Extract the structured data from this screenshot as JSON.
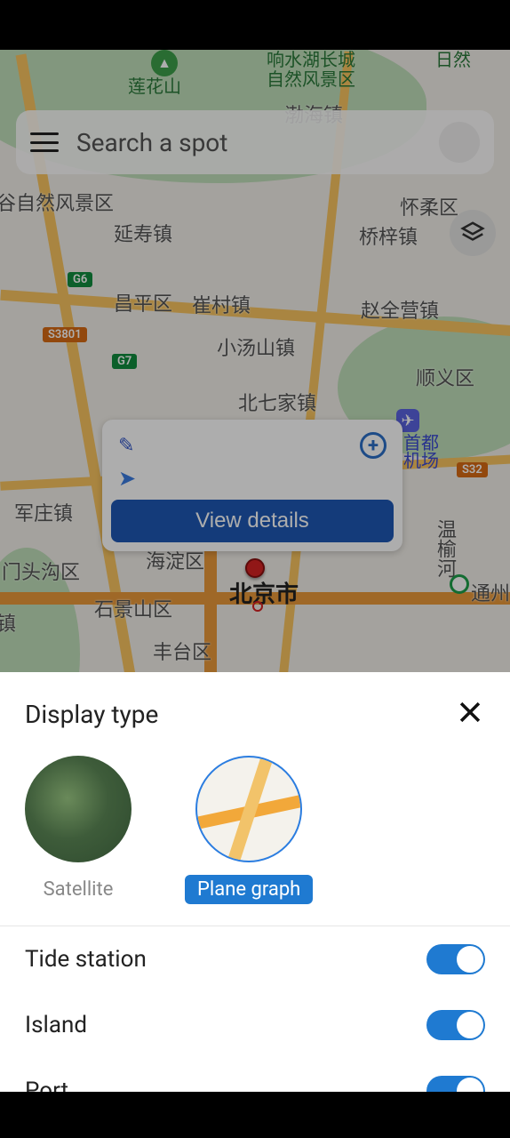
{
  "search": {
    "placeholder": "Search a spot"
  },
  "center_card": {
    "view_details": "View details"
  },
  "map": {
    "city": "北京市",
    "peak": "莲花山",
    "scenic": "响水湖长城\n自然风景区",
    "partial_scenic": "谷自然风景区",
    "airport": "首都\n机场",
    "labels": {
      "ys": "延寿镇",
      "qz": "桥梓镇",
      "hr": "怀柔区",
      "cp": "昌平区",
      "cc": "崔村镇",
      "zqy": "赵全营镇",
      "xts": "小汤山镇",
      "sy": "顺义区",
      "bqj": "北七家镇",
      "jz": "军庄镇",
      "wyh": "温榆河",
      "mtg": "门头沟区",
      "tz": "通州",
      "sjs": "石景山区",
      "hd": "海淀区",
      "ft": "丰台区",
      "town": "镇",
      "bhz": "渤海镇",
      "rx": "日然"
    },
    "roads": {
      "g6": "G6",
      "g7": "G7",
      "s3801": "S3801",
      "s32": "S32"
    }
  },
  "sheet": {
    "title": "Display type",
    "types": [
      {
        "id": "satellite",
        "label": "Satellite",
        "active": false
      },
      {
        "id": "plane",
        "label": "Plane graph",
        "active": true
      }
    ],
    "toggles": [
      {
        "id": "tide",
        "label": "Tide station",
        "on": true
      },
      {
        "id": "island",
        "label": "Island",
        "on": true
      },
      {
        "id": "port",
        "label": "Port",
        "on": true
      }
    ]
  }
}
